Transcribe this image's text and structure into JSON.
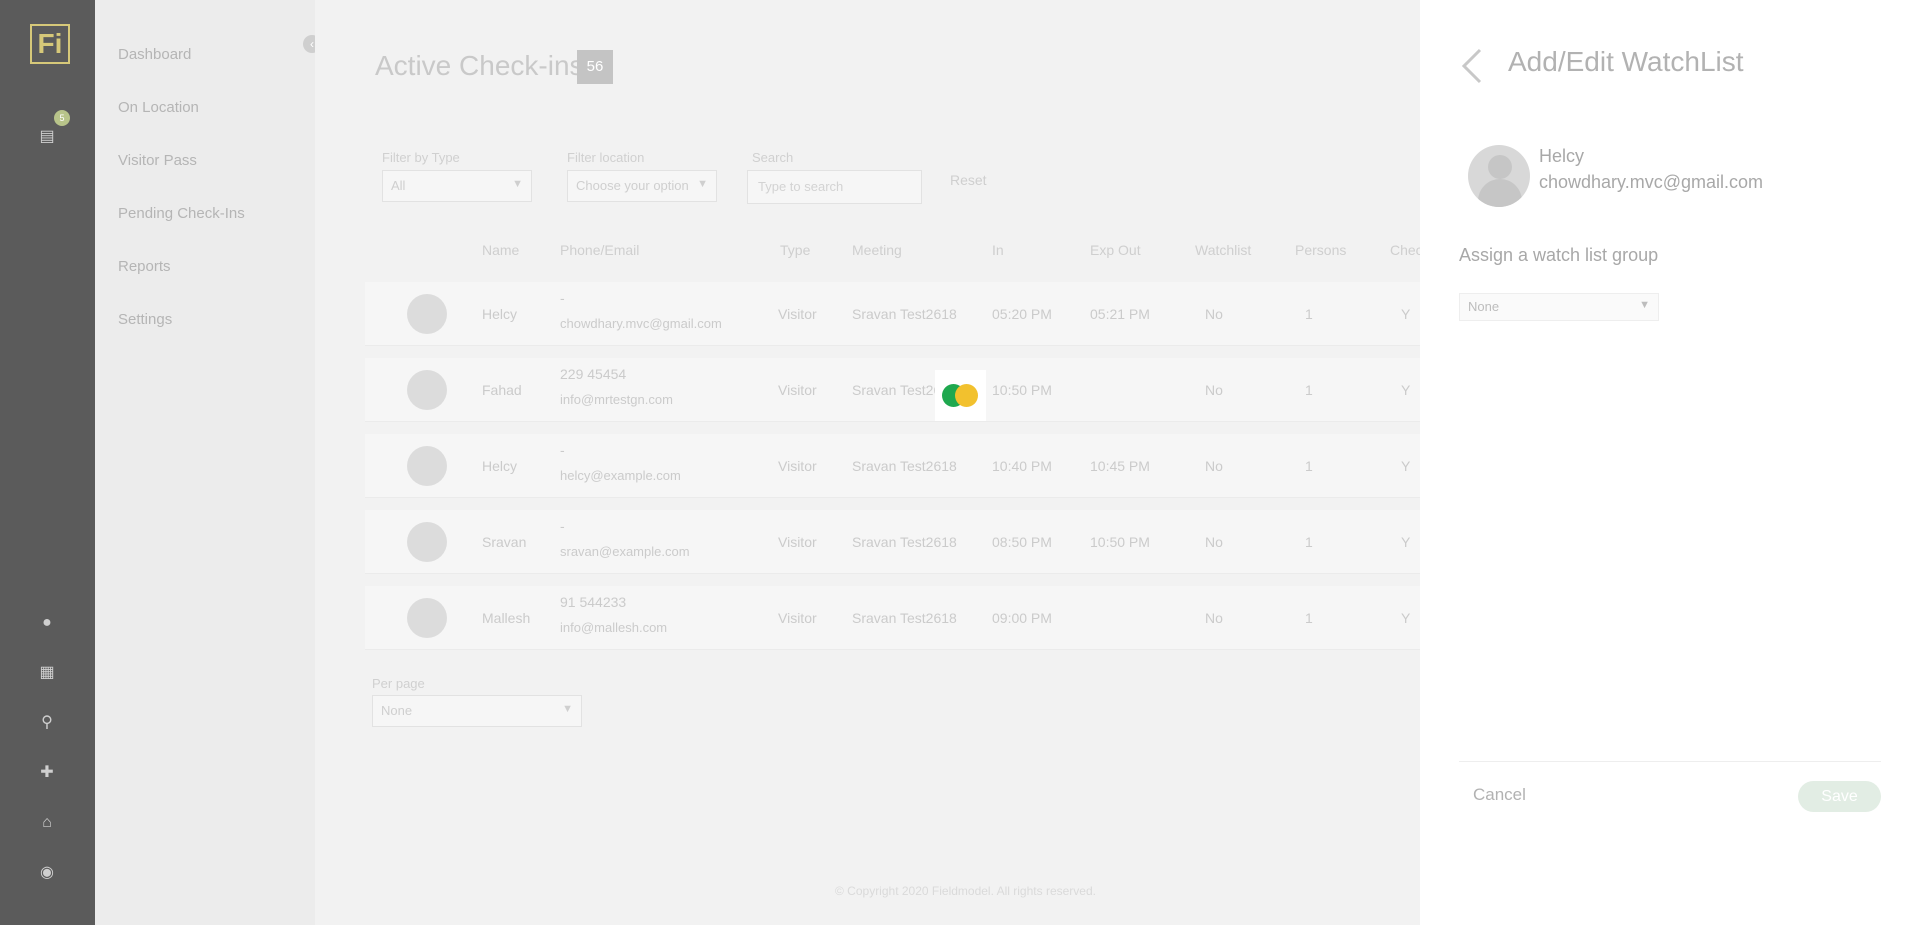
{
  "app": {
    "logo_text": "Fi",
    "notification_count": "5"
  },
  "nav": {
    "items": [
      {
        "label": "Dashboard"
      },
      {
        "label": "On Location"
      },
      {
        "label": "Visitor Pass"
      },
      {
        "label": "Pending Check-Ins"
      },
      {
        "label": "Reports"
      },
      {
        "label": "Settings"
      }
    ]
  },
  "main": {
    "title": "Active Check-ins",
    "count": "56",
    "filters": {
      "filter_by_type_label": "Filter by Type",
      "filter_by_type_value": "All",
      "filter_by_location_label": "Filter location",
      "filter_by_location_value": "Choose your option",
      "search_label": "Search",
      "search_placeholder": "Type to search",
      "reset_label": "Reset"
    },
    "columns": [
      "Name",
      "Phone/Email",
      "Type",
      "Meeting",
      "In",
      "Exp Out",
      "Watchlist",
      "Persons",
      "Chec"
    ],
    "rows": [
      {
        "name": "Helcy",
        "phone": "-",
        "email": "chowdhary.mvc@gmail.com",
        "type": "Visitor",
        "meeting": "Sravan Test2618",
        "in": "05:20 PM",
        "exp_out": "05:21 PM",
        "watchlist": "No",
        "persons": "1",
        "check": "Y"
      },
      {
        "name": "Fahad",
        "phone": "229 45454",
        "email": "info@mrtestgn.com",
        "type": "Visitor",
        "meeting": "Sravan Test2618",
        "in": "10:50 PM",
        "exp_out": "",
        "watchlist": "No",
        "persons": "1",
        "check": "Y"
      },
      {
        "name": "Helcy",
        "phone": "-",
        "email": "helcy@example.com",
        "type": "Visitor",
        "meeting": "Sravan Test2618",
        "in": "10:40 PM",
        "exp_out": "10:45 PM",
        "watchlist": "No",
        "persons": "1",
        "check": "Y"
      },
      {
        "name": "Sravan",
        "phone": "-",
        "email": "sravan@example.com",
        "type": "Visitor",
        "meeting": "Sravan Test2618",
        "in": "08:50 PM",
        "exp_out": "10:50 PM",
        "watchlist": "No",
        "persons": "1",
        "check": "Y"
      },
      {
        "name": "Mallesh",
        "phone": "91 544233",
        "email": "info@mallesh.com",
        "type": "Visitor",
        "meeting": "Sravan Test2618",
        "in": "09:00 PM",
        "exp_out": "",
        "watchlist": "No",
        "persons": "1",
        "check": "Y"
      }
    ],
    "per_page_label": "Per page",
    "per_page_value": "None",
    "footer_text": "© Copyright 2020 Fieldmodel. All rights reserved."
  },
  "panel": {
    "title": "Add/Edit WatchList",
    "person_name": "Helcy",
    "person_email": "chowdhary.mvc@gmail.com",
    "assign_label": "Assign a watch list group",
    "group_value": "None",
    "cancel_label": "Cancel",
    "save_label": "Save"
  },
  "colors": {
    "loader_green": "#1fa84f",
    "loader_yellow": "#f2c12e",
    "save_disabled": "#e2ede4"
  }
}
